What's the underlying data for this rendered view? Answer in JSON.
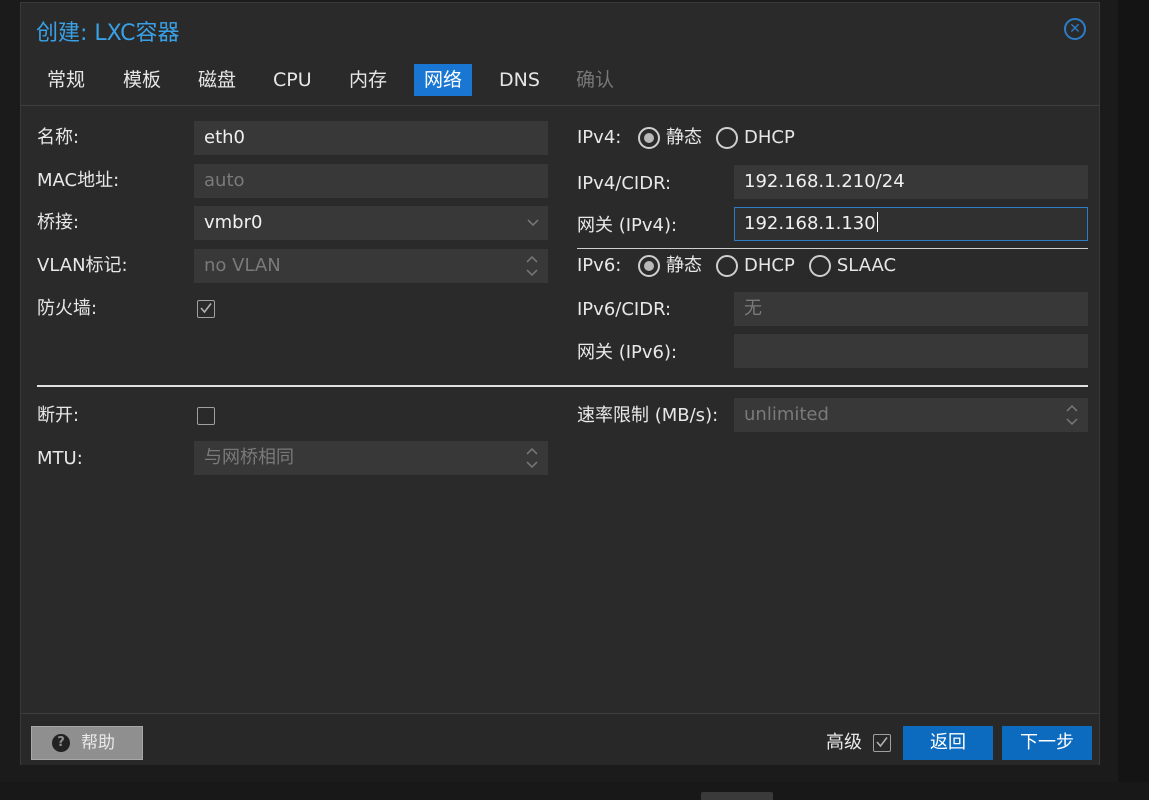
{
  "dialog": {
    "title": "创建: LXC容器",
    "close_icon": "close-circle-icon"
  },
  "tabs": [
    {
      "label": "常规",
      "state": "normal"
    },
    {
      "label": "模板",
      "state": "normal"
    },
    {
      "label": "磁盘",
      "state": "normal"
    },
    {
      "label": "CPU",
      "state": "normal"
    },
    {
      "label": "内存",
      "state": "normal"
    },
    {
      "label": "网络",
      "state": "active"
    },
    {
      "label": "DNS",
      "state": "normal"
    },
    {
      "label": "确认",
      "state": "disabled"
    }
  ],
  "left": {
    "name_label": "名称:",
    "name_value": "eth0",
    "mac_label": "MAC地址:",
    "mac_placeholder": "auto",
    "bridge_label": "桥接:",
    "bridge_value": "vmbr0",
    "vlan_label": "VLAN标记:",
    "vlan_placeholder": "no VLAN",
    "firewall_label": "防火墙:",
    "firewall_checked": true
  },
  "right": {
    "ipv4_label": "IPv4:",
    "ipv4_options": [
      {
        "label": "静态",
        "checked": true
      },
      {
        "label": "DHCP",
        "checked": false
      }
    ],
    "ipv4_cidr_label": "IPv4/CIDR:",
    "ipv4_cidr_value": "192.168.1.210/24",
    "gw4_label": "网关 (IPv4):",
    "gw4_value": "192.168.1.130",
    "ipv6_label": "IPv6:",
    "ipv6_options": [
      {
        "label": "静态",
        "checked": true
      },
      {
        "label": "DHCP",
        "checked": false
      },
      {
        "label": "SLAAC",
        "checked": false
      }
    ],
    "ipv6_cidr_label": "IPv6/CIDR:",
    "ipv6_cidr_placeholder": "无",
    "gw6_label": "网关 (IPv6):",
    "gw6_value": ""
  },
  "advanced": {
    "disconnect_label": "断开:",
    "disconnect_checked": false,
    "mtu_label": "MTU:",
    "mtu_placeholder": "与网桥相同",
    "rate_label": "速率限制 (MB/s):",
    "rate_placeholder": "unlimited"
  },
  "footer": {
    "help_label": "帮助",
    "help_icon": "question-circle-icon",
    "advanced_label": "高级",
    "advanced_checked": true,
    "back_label": "返回",
    "next_label": "下一步"
  }
}
